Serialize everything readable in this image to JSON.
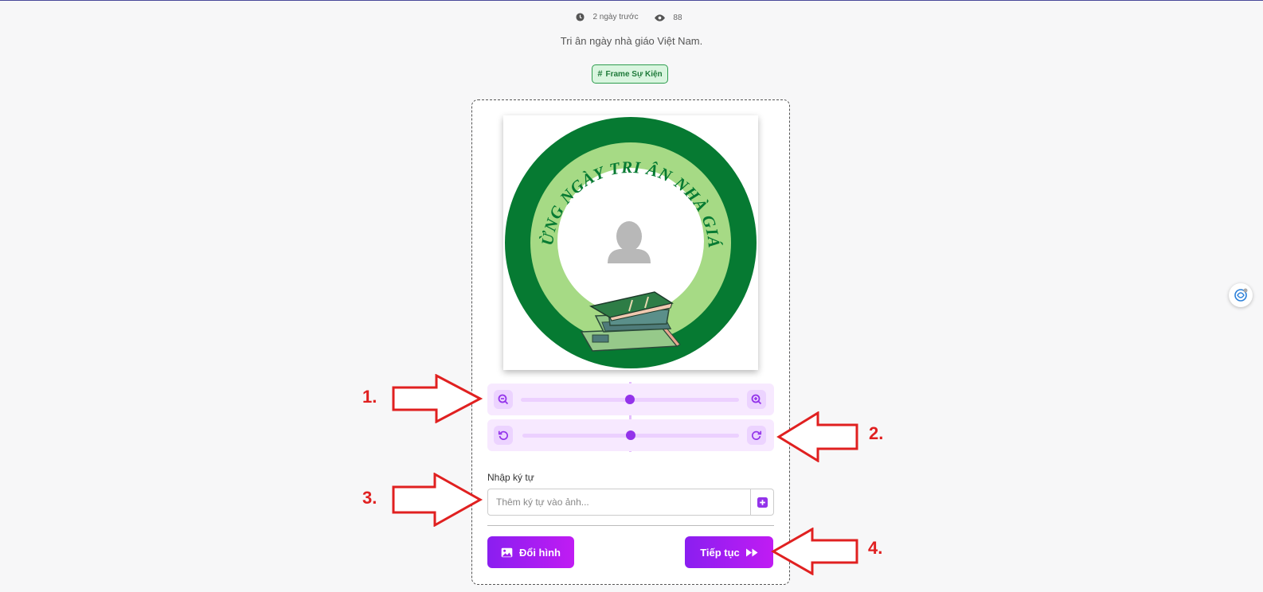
{
  "meta": {
    "time_ago": "2 ngày trước",
    "views": "88"
  },
  "description": "Tri ân ngày nhà giáo Việt Nam.",
  "tag": {
    "label": "Frame Sự Kiện"
  },
  "frame": {
    "arc_text": "MỪNG NGÀY TRI ÂN NHÀ GIÁO",
    "colors": {
      "outer_ring": "#067a32",
      "inner_ring": "#a6da85"
    }
  },
  "controls": {
    "zoom_level": 0.5,
    "rotate_level": 0.5
  },
  "text_input": {
    "label": "Nhập ký tự",
    "placeholder": "Thêm ký tự vào ảnh..."
  },
  "buttons": {
    "change_image": "Đổi hình",
    "continue": "Tiếp tục"
  },
  "annotations": [
    "1.",
    "2.",
    "3.",
    "4."
  ],
  "colors": {
    "accent": "#9333ea",
    "annotation": "#e02020",
    "tag_green": "#2e9d4e"
  }
}
